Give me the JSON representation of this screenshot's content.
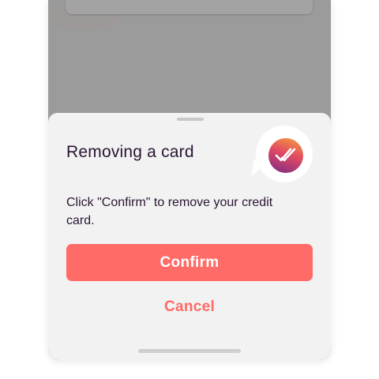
{
  "dialog": {
    "title": "Removing a card",
    "message": "Click \"Confirm\" to remove your credit card.",
    "confirm_label": "Confirm",
    "cancel_label": "Cancel",
    "icon": "double-check-badge-icon"
  },
  "colors": {
    "accent": "#ff6b66",
    "title_text": "#2a1533",
    "overlay": "#9b9b9b",
    "sheet": "#f2f2f2",
    "badge_gradient": [
      "#f9a23a",
      "#e24a62",
      "#7a2a86"
    ]
  }
}
